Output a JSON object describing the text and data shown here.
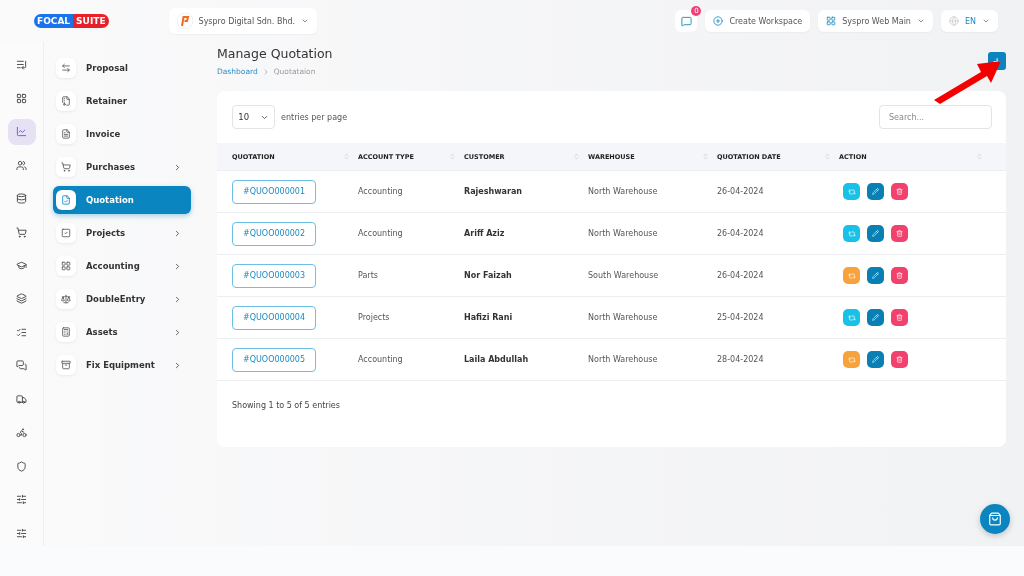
{
  "header": {
    "logo": {
      "left": "FOCAL",
      "right": "SUITE"
    },
    "company": "Syspro Digital Sdn. Bhd.",
    "notification_count": "0",
    "create_workspace": "Create Workspace",
    "workspace": "Syspro Web Main",
    "language": "EN"
  },
  "rail": [
    {
      "selected": false
    },
    {
      "selected": false
    },
    {
      "selected": true
    },
    {
      "selected": false
    },
    {
      "selected": false
    },
    {
      "selected": false
    },
    {
      "selected": false
    },
    {
      "selected": false
    },
    {
      "selected": false
    },
    {
      "selected": false
    },
    {
      "selected": false
    },
    {
      "selected": false
    },
    {
      "selected": false
    },
    {
      "selected": false
    },
    {
      "selected": false
    }
  ],
  "sidebar": {
    "items": [
      {
        "label": "Proposal",
        "selected": false,
        "expandable": false
      },
      {
        "label": "Retainer",
        "selected": false,
        "expandable": false
      },
      {
        "label": "Invoice",
        "selected": false,
        "expandable": false
      },
      {
        "label": "Purchases",
        "selected": false,
        "expandable": true
      },
      {
        "label": "Quotation",
        "selected": true,
        "expandable": false
      },
      {
        "label": "Projects",
        "selected": false,
        "expandable": true
      },
      {
        "label": "Accounting",
        "selected": false,
        "expandable": true
      },
      {
        "label": "DoubleEntry",
        "selected": false,
        "expandable": true
      },
      {
        "label": "Assets",
        "selected": false,
        "expandable": true
      },
      {
        "label": "Fix Equipment",
        "selected": false,
        "expandable": true
      }
    ]
  },
  "page": {
    "title": "Manage Quotation",
    "breadcrumb": [
      "Dashboard",
      "Quotataion"
    ],
    "add_button": "+"
  },
  "table": {
    "page_size": "10",
    "page_size_label": "entries per page",
    "search": {
      "placeholder": "Search..."
    },
    "columns": [
      "QUOTATION",
      "ACCOUNT TYPE",
      "CUSTOMER",
      "WAREHOUSE",
      "QUOTATION DATE",
      "ACTION"
    ],
    "rows": [
      {
        "quotation": "#QUOO000001",
        "account_type": "Accounting",
        "customer": "Rajeshwaran",
        "warehouse": "North Warehouse",
        "date": "26-04-2024",
        "color": "#17c1e8"
      },
      {
        "quotation": "#QUOO000002",
        "account_type": "Accounting",
        "customer": "Ariff Aziz",
        "warehouse": "North Warehouse",
        "date": "26-04-2024",
        "color": "#17c1e8"
      },
      {
        "quotation": "#QUOO000003",
        "account_type": "Parts",
        "customer": "Nor Faizah",
        "warehouse": "South Warehouse",
        "date": "26-04-2024",
        "color": "#f7a23b"
      },
      {
        "quotation": "#QUOO000004",
        "account_type": "Projects",
        "customer": "Hafizi Rani",
        "warehouse": "North Warehouse",
        "date": "25-04-2024",
        "color": "#17c1e8"
      },
      {
        "quotation": "#QUOO000005",
        "account_type": "Accounting",
        "customer": "Laila Abdullah",
        "warehouse": "North Warehouse",
        "date": "28-04-2024",
        "color": "#f7a23b"
      }
    ],
    "summary": "Showing 1 to 5 of 5 entries"
  }
}
